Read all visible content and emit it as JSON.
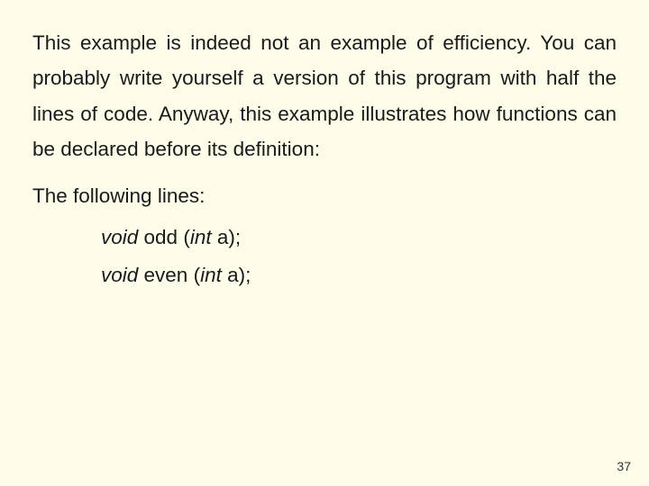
{
  "para1": "This example is indeed not an example of efficiency. You can probably write yourself a version of this program with half the lines of code. Anyway, this example illustrates how functions can be declared before its definition:",
  "para2": "The following lines:",
  "code1": {
    "ret": "void",
    "name": " odd (",
    "argtype": "int",
    "tail": " a);"
  },
  "code2": {
    "ret": "void",
    "name": " even (",
    "argtype": "int",
    "tail": " a);"
  },
  "page": "37"
}
